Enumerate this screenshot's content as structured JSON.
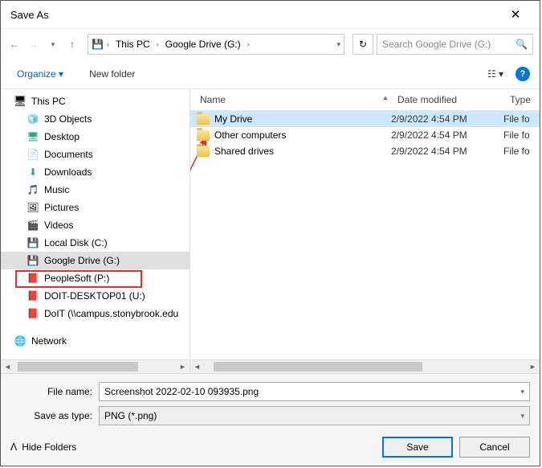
{
  "title": "Save As",
  "breadcrumb": [
    "This PC",
    "Google Drive (G:)"
  ],
  "search_placeholder": "Search Google Drive (G:)",
  "toolbar": {
    "organize": "Organize ▾",
    "new_folder": "New folder"
  },
  "help_icon": "?",
  "view_icon": "☷ ▾",
  "tree": [
    {
      "label": "This PC",
      "icon": "icon-pc",
      "indent": false
    },
    {
      "label": "3D Objects",
      "icon": "icon-3d",
      "indent": true
    },
    {
      "label": "Desktop",
      "icon": "icon-desk",
      "indent": true
    },
    {
      "label": "Documents",
      "icon": "icon-doc",
      "indent": true
    },
    {
      "label": "Downloads",
      "icon": "icon-dl",
      "indent": true
    },
    {
      "label": "Music",
      "icon": "icon-music",
      "indent": true
    },
    {
      "label": "Pictures",
      "icon": "icon-pic",
      "indent": true
    },
    {
      "label": "Videos",
      "icon": "icon-vid",
      "indent": true
    },
    {
      "label": "Local Disk (C:)",
      "icon": "icon-disk",
      "indent": true
    },
    {
      "label": "Google Drive (G:)",
      "icon": "icon-drv",
      "indent": true,
      "selected": true
    },
    {
      "label": "PeopleSoft (P:)",
      "icon": "icon-app",
      "indent": true
    },
    {
      "label": "DOIT-DESKTOP01 (U:)",
      "icon": "icon-app",
      "indent": true
    },
    {
      "label": "DoIT (\\\\campus.stonybrook.edu",
      "icon": "icon-app",
      "indent": true
    },
    {
      "label": "Network",
      "icon": "icon-net",
      "indent": false,
      "gap": true
    }
  ],
  "columns": {
    "name": "Name",
    "date": "Date modified",
    "type": "Type"
  },
  "rows": [
    {
      "name": "My Drive",
      "date": "2/9/2022 4:54 PM",
      "type": "File fo",
      "selected": true
    },
    {
      "name": "Other computers",
      "date": "2/9/2022 4:54 PM",
      "type": "File fo"
    },
    {
      "name": "Shared drives",
      "date": "2/9/2022 4:54 PM",
      "type": "File fo"
    }
  ],
  "filename_label": "File name:",
  "filename_value": "Screenshot 2022-02-10 093935.png",
  "filetype_label": "Save as type:",
  "filetype_value": "PNG (*.png)",
  "hide_folders": "Hide Folders",
  "buttons": {
    "save": "Save",
    "cancel": "Cancel"
  }
}
